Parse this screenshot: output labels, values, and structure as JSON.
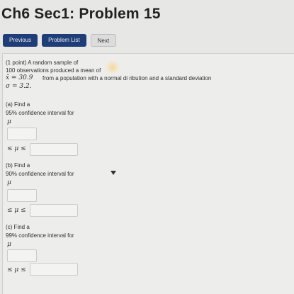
{
  "page": {
    "title": "Ch6 Sec1: Problem 15"
  },
  "nav": {
    "previous": "Previous",
    "problem_list": "Problem List",
    "next": "Next"
  },
  "problem": {
    "line1": "(1 point) A random sample of",
    "line2": "100 observations produced a mean of",
    "line3_sym": "x̄ = 30.9",
    "line3_text": "from a population with a normal di  ribution and a standard deviation",
    "line4": "σ = 3.2."
  },
  "parts": [
    {
      "heading": "(a) Find a",
      "level": "95% confidence interval for",
      "mu": "μ",
      "ineq": "≤ μ ≤"
    },
    {
      "heading": "(b) Find a",
      "level": "90% confidence interval for",
      "mu": "μ",
      "ineq": "≤ μ ≤"
    },
    {
      "heading": "(c) Find a",
      "level": "99% confidence interval for",
      "mu": "μ",
      "ineq": "≤ μ ≤"
    }
  ]
}
